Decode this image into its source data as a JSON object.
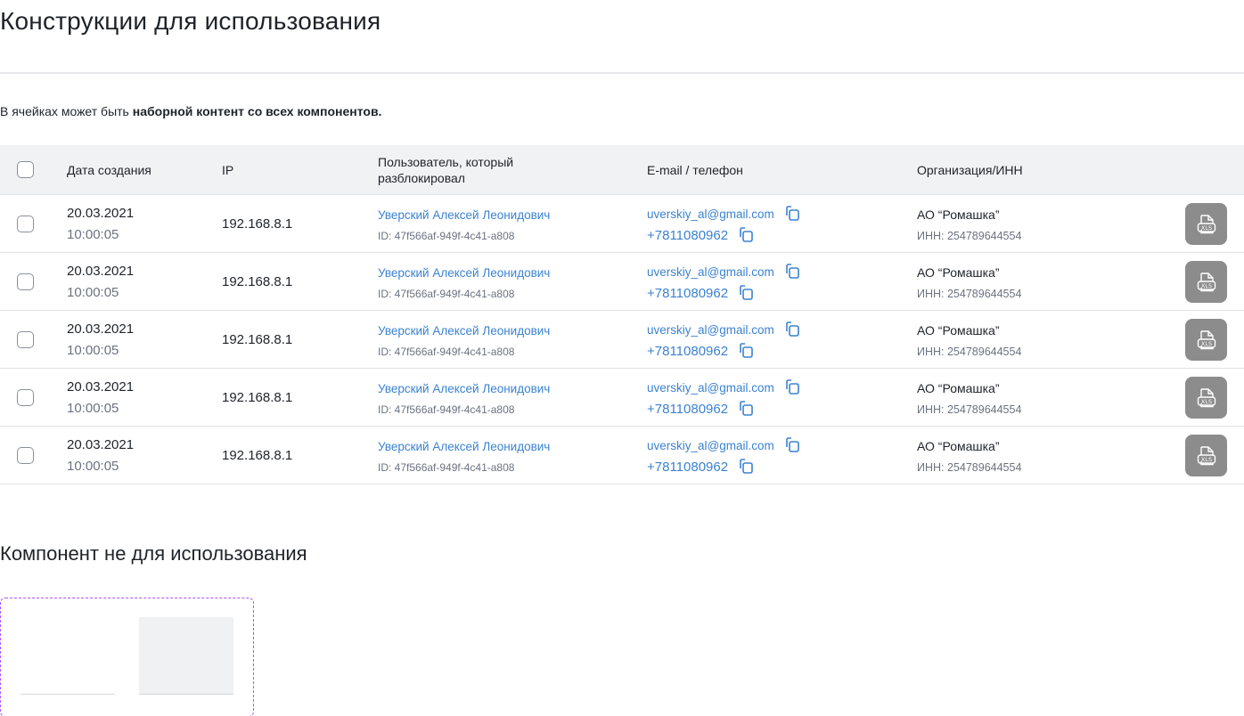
{
  "page": {
    "title": "Конструкции для использования",
    "intro_prefix": "В ячейках может быть ",
    "intro_bold": "наборной контент со всех компонентов."
  },
  "table": {
    "headers": {
      "date": "Дата создания",
      "ip": "IP",
      "user_line1": "Пользователь, который",
      "user_line2": "разблокировал",
      "contact": "E-mail / телефон",
      "org": "Организация/ИНН"
    },
    "rows": [
      {
        "date": "20.03.2021",
        "time": "10:00:05",
        "ip": "192.168.8.1",
        "user": "Уверский Алексей Леонидович",
        "user_id": "ID: 47f566af-949f-4c41-a808",
        "email": "uverskiy_al@gmail.com",
        "phone": "+7811080962",
        "org": "АО “Ромашка”",
        "inn": "ИНН: 254789644554"
      },
      {
        "date": "20.03.2021",
        "time": "10:00:05",
        "ip": "192.168.8.1",
        "user": "Уверский Алексей Леонидович",
        "user_id": "ID: 47f566af-949f-4c41-a808",
        "email": "uverskiy_al@gmail.com",
        "phone": "+7811080962",
        "org": "АО “Ромашка”",
        "inn": "ИНН: 254789644554"
      },
      {
        "date": "20.03.2021",
        "time": "10:00:05",
        "ip": "192.168.8.1",
        "user": "Уверский Алексей Леонидович",
        "user_id": "ID: 47f566af-949f-4c41-a808",
        "email": "uverskiy_al@gmail.com",
        "phone": "+7811080962",
        "org": "АО “Ромашка”",
        "inn": "ИНН: 254789644554"
      },
      {
        "date": "20.03.2021",
        "time": "10:00:05",
        "ip": "192.168.8.1",
        "user": "Уверский Алексей Леонидович",
        "user_id": "ID: 47f566af-949f-4c41-a808",
        "email": "uverskiy_al@gmail.com",
        "phone": "+7811080962",
        "org": "АО “Ромашка”",
        "inn": "ИНН: 254789644554"
      },
      {
        "date": "20.03.2021",
        "time": "10:00:05",
        "ip": "192.168.8.1",
        "user": "Уверский Алексей Леонидович",
        "user_id": "ID: 47f566af-949f-4c41-a808",
        "email": "uverskiy_al@gmail.com",
        "phone": "+7811080962",
        "org": "АО “Ромашка”",
        "inn": "ИНН: 254789644554"
      }
    ],
    "icons": {
      "copy": "copy-icon",
      "export": "xls-file-icon"
    },
    "colors": {
      "link": "#3b82d1",
      "header_bg": "#f1f2f4",
      "export_btn": "#8c8c8c"
    }
  },
  "section2": {
    "title": "Компонент не для использования",
    "border_color": "#a855f7"
  }
}
